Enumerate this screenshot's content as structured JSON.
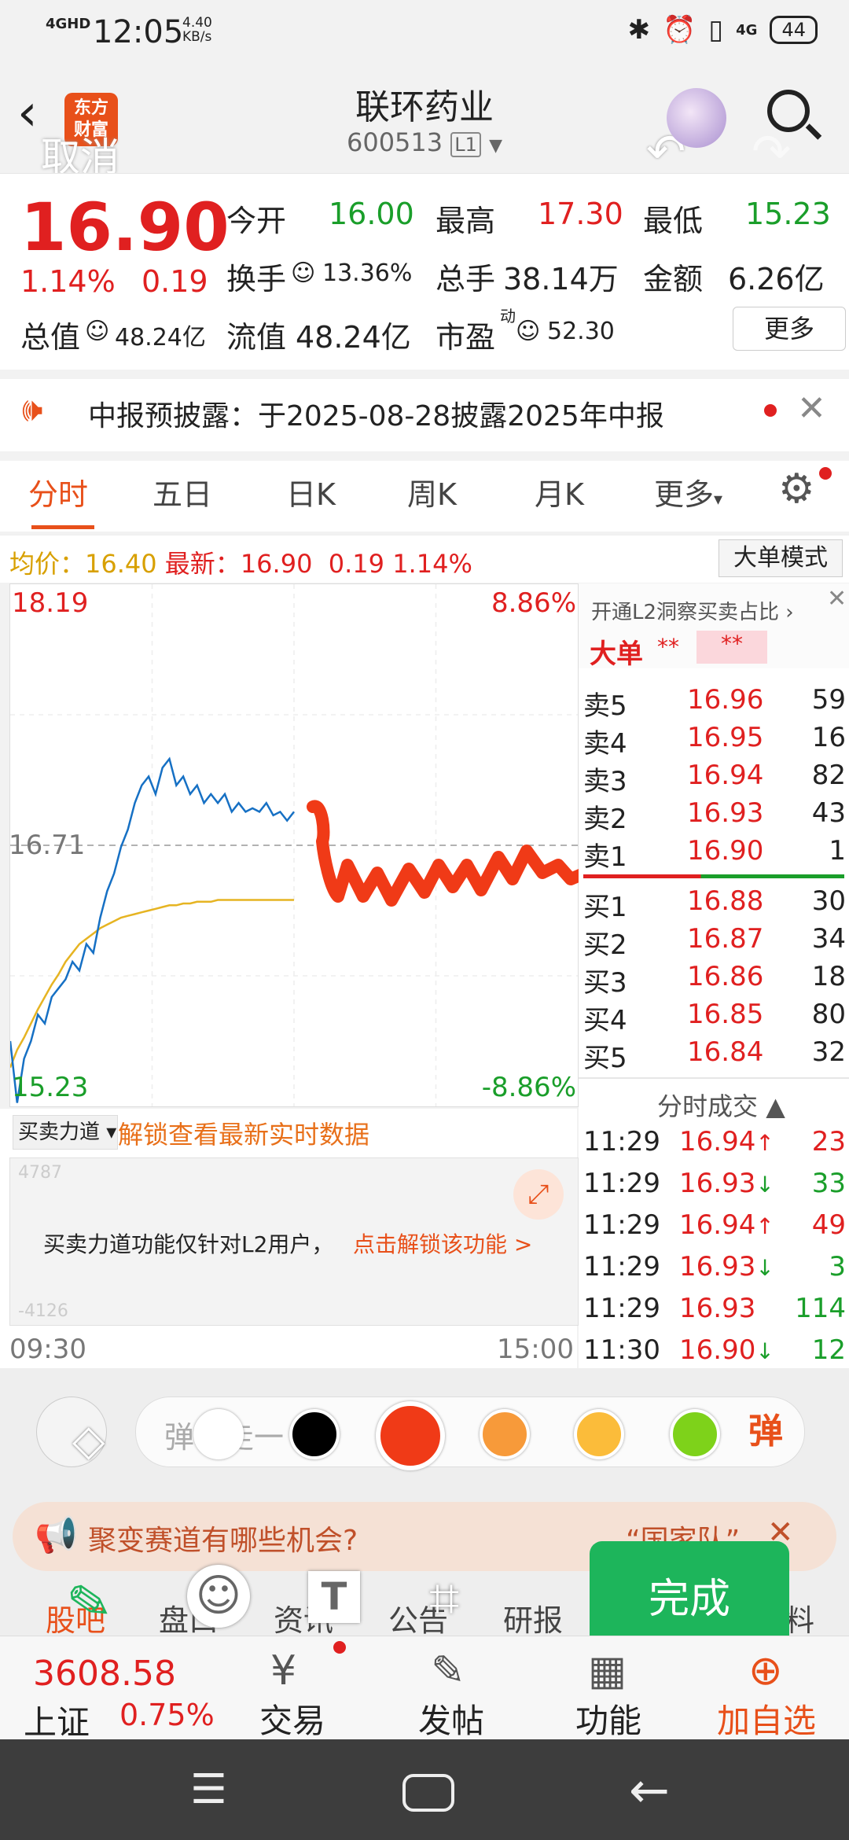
{
  "status_bar": {
    "network": "4GHD",
    "time": "12:05",
    "speed": "4.40",
    "speed_unit": "KB/s",
    "signal": "4G",
    "battery": "44"
  },
  "header": {
    "cancel_label": "取消",
    "logo_text": "东方财富",
    "stock_name": "联环药业",
    "stock_code": "600513",
    "level_badge": "L1"
  },
  "quote": {
    "price": "16.90",
    "change_pct": "1.14%",
    "change": "0.19",
    "open_label": "今开",
    "open": "16.00",
    "high_label": "最高",
    "high": "17.30",
    "low_label": "最低",
    "low": "15.23",
    "turnover_label": "换手",
    "turnover": "13.36%",
    "volume_label": "总手",
    "volume": "38.14万",
    "amount_label": "金额",
    "amount": "6.26亿",
    "mktcap_label": "总值",
    "mktcap": "48.24亿",
    "float_label": "流值",
    "float": "48.24亿",
    "pe_label": "市盈",
    "pe_sup": "动",
    "pe": "52.30",
    "more_label": "更多"
  },
  "notice": {
    "text": "中报预披露：于2025-08-28披露2025年中报"
  },
  "tabs": [
    {
      "label": "分时"
    },
    {
      "label": "五日"
    },
    {
      "label": "日K"
    },
    {
      "label": "周K"
    },
    {
      "label": "月K"
    },
    {
      "label": "更多"
    }
  ],
  "avg_line": {
    "avg_label": "均价：",
    "avg": "16.40",
    "latest_label": "最新：",
    "latest": "16.90",
    "chg": "0.19",
    "pct": "1.14%",
    "mode_button": "大单模式"
  },
  "chart_data": {
    "type": "line",
    "top_price": "18.19",
    "top_pct": "8.86%",
    "mid_price": "16.71",
    "bottom_price": "15.23",
    "bottom_pct": "-8.86%",
    "x_start": "09:30",
    "x_end": "15:00",
    "ylim": [
      15.23,
      18.19
    ],
    "price_series": [
      15.6,
      15.25,
      15.5,
      15.6,
      15.75,
      15.7,
      15.85,
      15.9,
      15.95,
      16.05,
      16.0,
      16.15,
      16.1,
      16.3,
      16.45,
      16.55,
      16.7,
      16.8,
      16.95,
      17.05,
      17.1,
      17.0,
      17.15,
      17.2,
      17.05,
      17.1,
      17.0,
      17.05,
      16.95,
      17.0,
      16.95,
      17.0,
      16.9,
      16.95,
      16.9,
      16.92,
      16.9,
      16.95,
      16.88,
      16.9,
      16.85,
      16.9
    ],
    "avg_series": [
      15.45,
      15.55,
      15.62,
      15.7,
      15.78,
      15.85,
      15.92,
      15.98,
      16.05,
      16.1,
      16.15,
      16.18,
      16.21,
      16.24,
      16.26,
      16.28,
      16.3,
      16.31,
      16.32,
      16.33,
      16.34,
      16.35,
      16.36,
      16.37,
      16.37,
      16.38,
      16.38,
      16.39,
      16.39,
      16.39,
      16.4,
      16.4,
      16.4,
      16.4,
      16.4,
      16.4,
      16.4,
      16.4,
      16.4,
      16.4,
      16.4,
      16.4
    ]
  },
  "panel": {
    "l2_text": "开通L2洞察买卖占比",
    "bigorder_label": "大单",
    "stars1": "**",
    "stars2": "**"
  },
  "sell_orders": [
    {
      "label": "卖5",
      "price": "16.96",
      "vol": "59"
    },
    {
      "label": "卖4",
      "price": "16.95",
      "vol": "16"
    },
    {
      "label": "卖3",
      "price": "16.94",
      "vol": "82"
    },
    {
      "label": "卖2",
      "price": "16.93",
      "vol": "43"
    },
    {
      "label": "卖1",
      "price": "16.90",
      "vol": "1"
    }
  ],
  "buy_orders": [
    {
      "label": "买1",
      "price": "16.88",
      "vol": "30"
    },
    {
      "label": "买2",
      "price": "16.87",
      "vol": "34"
    },
    {
      "label": "买3",
      "price": "16.86",
      "vol": "18"
    },
    {
      "label": "买4",
      "price": "16.85",
      "vol": "80"
    },
    {
      "label": "买5",
      "price": "16.84",
      "vol": "32"
    }
  ],
  "trades_title": "分时成交",
  "trades": [
    {
      "time": "11:29",
      "price": "16.94",
      "arrow": "↑",
      "vol": "23",
      "dir": "up"
    },
    {
      "time": "11:29",
      "price": "16.93",
      "arrow": "↓",
      "vol": "33",
      "dir": "down"
    },
    {
      "time": "11:29",
      "price": "16.94",
      "arrow": "↑",
      "vol": "49",
      "dir": "up"
    },
    {
      "time": "11:29",
      "price": "16.93",
      "arrow": "↓",
      "vol": "3",
      "dir": "down"
    },
    {
      "time": "11:29",
      "price": "16.93",
      "arrow": "",
      "vol": "114",
      "dir": "flat"
    },
    {
      "time": "11:30",
      "price": "16.90",
      "arrow": "↓",
      "vol": "12",
      "dir": "down"
    }
  ],
  "lower": {
    "dropdown": "买卖力道",
    "unlock": "解锁查看最新实时数据",
    "msg": "买卖力道功能仅针对L2用户，",
    "msg_link": "点击解锁该功能 >",
    "faint_top": "4787",
    "faint_bottom": "-4126"
  },
  "drawbar": {
    "input_placeholder": "弹幕走一",
    "color_swatches": [
      "#ffffff",
      "#000000",
      "#f03a17",
      "#f79a3a",
      "#fbbc3a",
      "#7ed21a"
    ],
    "banner_text": "聚变赛道有哪些机会?",
    "banner_right": "“国家队”",
    "done_label": "完成"
  },
  "sub_tabs": [
    {
      "label": "股吧"
    },
    {
      "label": "盘口"
    },
    {
      "label": "资讯"
    },
    {
      "label": "公告"
    },
    {
      "label": "研报"
    },
    {
      "label": "资料"
    }
  ],
  "bottom_nav": {
    "index_value": "3608.58",
    "index_name": "上证",
    "index_pct": "0.75%",
    "trade": "交易",
    "post": "发帖",
    "func": "功能",
    "add": "加自选"
  }
}
